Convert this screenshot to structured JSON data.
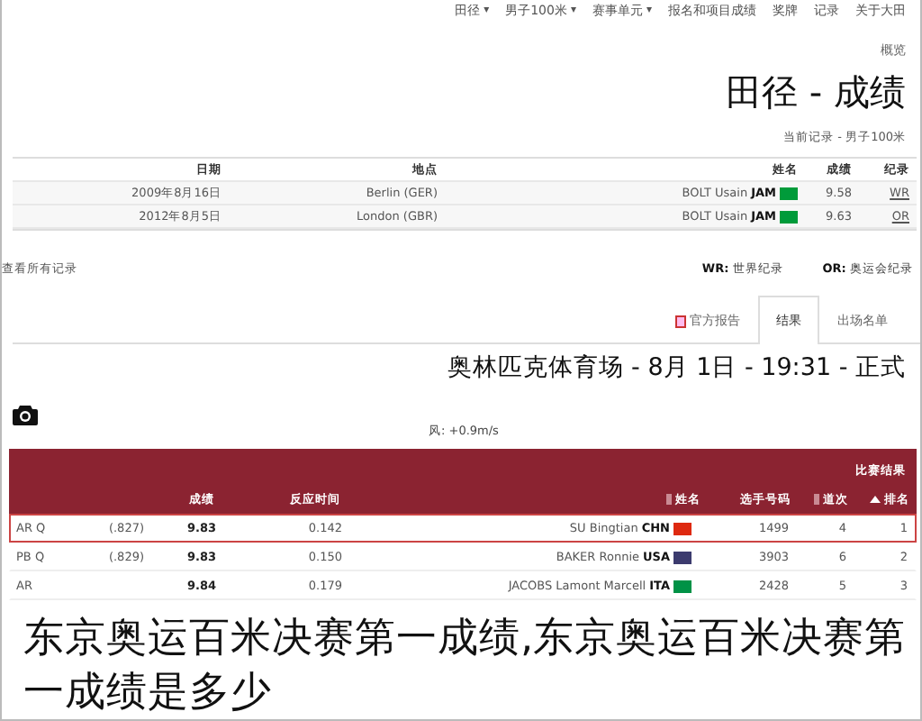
{
  "nav": [
    {
      "label": "田径",
      "caret": "▾"
    },
    {
      "label": "男子100米",
      "caret": "▾"
    },
    {
      "label": "赛事单元",
      "caret": "▾"
    },
    {
      "label": "报名和项目成绩"
    },
    {
      "label": "奖牌"
    },
    {
      "label": "记录"
    },
    {
      "label": "关于大田"
    }
  ],
  "breadcrumb": "概览",
  "title": "田径 - 成绩",
  "subtitle": "当前记录 - 男子100米",
  "records": {
    "columns": [
      "日期",
      "地点",
      "姓名",
      "成绩",
      "纪录"
    ],
    "rows": [
      {
        "record": "WR",
        "mark": "9.58",
        "country": "JAM",
        "name": "BOLT Usain",
        "color": "#009b3a",
        "place": "Berlin (GER)",
        "date": "2009年8月16日"
      },
      {
        "record": "OR",
        "mark": "9.63",
        "country": "JAM",
        "name": "BOLT Usain",
        "color": "#009b3a",
        "place": "London (GBR)",
        "date": "2012年8月5日"
      }
    ]
  },
  "all_records_link": "查看所有记录",
  "legend": [
    "WR: 世界纪录",
    "OR: 奥运会纪录"
  ],
  "tabs": [
    {
      "label": "官方报告",
      "selected": false,
      "kind": "pdf"
    },
    {
      "label": "结果",
      "selected": true,
      "kind": "plain"
    },
    {
      "label": "出场名单",
      "selected": false,
      "kind": "plain"
    }
  ],
  "heading": "奥林匹克体育场 - 8月 1日 - 19:31 - 正式",
  "wind": "风: +0.9m/s",
  "results": {
    "title": "比赛结果",
    "columns": [
      "成绩",
      "反应时间",
      "姓名",
      "选手号码",
      "道次",
      "排名"
    ],
    "rows": [
      {
        "rank": "1",
        "lane": "4",
        "bib": "1499",
        "country": "CHN",
        "name": "SU Bingtian",
        "color": "#de2910",
        "reaction": "0.142",
        "mark": "9.83",
        "column_7": "(.827)",
        "column_8": "AR Q",
        "selected": true
      },
      {
        "rank": "2",
        "lane": "6",
        "bib": "3903",
        "country": "USA",
        "name": "BAKER Ronnie",
        "color": "#3c3b6e",
        "reaction": "0.150",
        "mark": "9.83",
        "column_7": "(.829)",
        "column_8": "PB Q",
        "selected": false
      },
      {
        "rank": "3",
        "lane": "5",
        "bib": "2428",
        "country": "ITA",
        "name": "JACOBS Lamont Marcell",
        "color": "#009246",
        "reaction": "0.179",
        "mark": "9.84",
        "column_8": "AR",
        "selected": false
      }
    ]
  },
  "caption": "东京奥运百米决赛第一成绩,东京奥运百米决赛第一成绩是多少"
}
